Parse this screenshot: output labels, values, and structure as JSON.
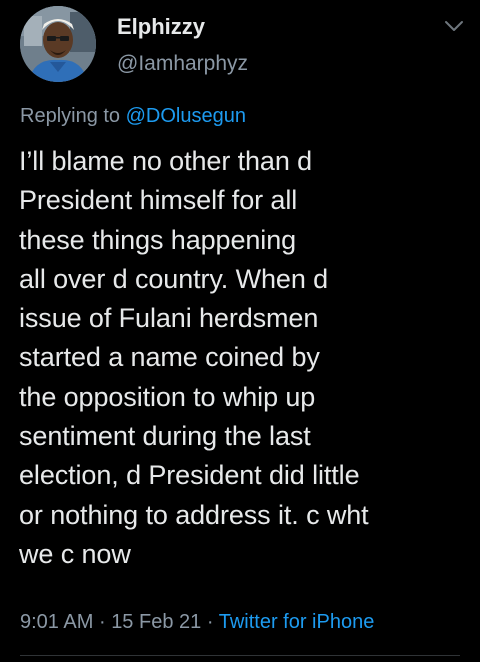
{
  "tweet": {
    "author": {
      "display_name": "Elphizzy",
      "handle": "@Iamharphyz",
      "avatar_icon": "profile-avatar"
    },
    "menu_icon": "chevron-down-icon",
    "reply": {
      "prefix": "Replying to",
      "handle": "@DOlusegun"
    },
    "text": "I’ll blame no other than d\nPresident himself for all\nthese things happening\nall over d country. When d\nissue of Fulani herdsmen\nstarted a name coined by\nthe opposition to whip up\nsentiment during the last\nelection, d President did little\nor nothing to address it. c wht\nwe c now",
    "time": "9:01 AM",
    "separator": "·",
    "date": "15 Feb 21",
    "source": "Twitter for iPhone"
  },
  "colors": {
    "background": "#000000",
    "primary_text": "#e7e9ea",
    "secondary_text": "#8b98a5",
    "link": "#1d9bf0",
    "divider": "#2f3336"
  }
}
